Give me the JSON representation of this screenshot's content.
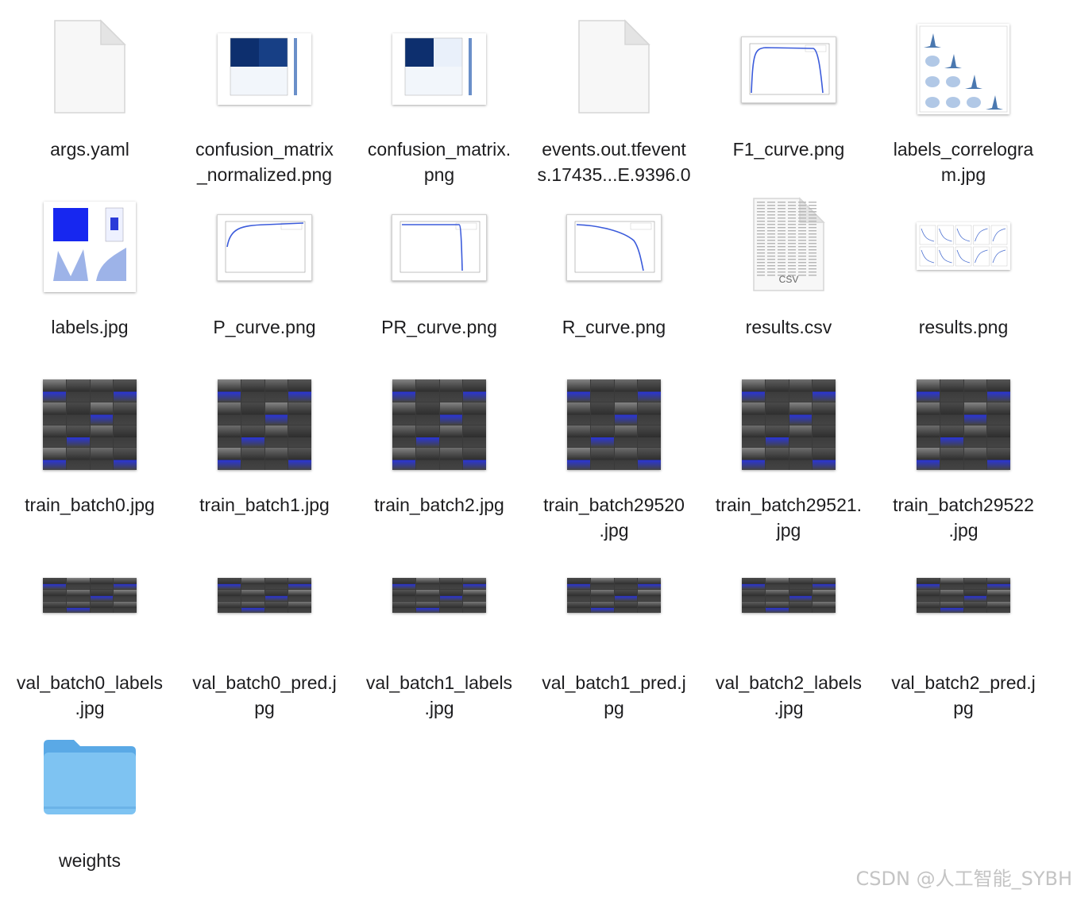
{
  "files": [
    {
      "name": "args.yaml",
      "kind": "doc"
    },
    {
      "name": "confusion_matrix_normalized.png",
      "kind": "cm"
    },
    {
      "name": "confusion_matrix.png",
      "kind": "cm2"
    },
    {
      "name": "events.out.tfevents.17435...E.9396.0",
      "kind": "doc"
    },
    {
      "name": "F1_curve.png",
      "kind": "curve"
    },
    {
      "name": "labels_correlogram.jpg",
      "kind": "correlogram"
    },
    {
      "name": "labels.jpg",
      "kind": "labels"
    },
    {
      "name": "P_curve.png",
      "kind": "curve"
    },
    {
      "name": "PR_curve.png",
      "kind": "curve"
    },
    {
      "name": "R_curve.png",
      "kind": "curve"
    },
    {
      "name": "results.csv",
      "kind": "csv"
    },
    {
      "name": "results.png",
      "kind": "results"
    },
    {
      "name": "train_batch0.jpg",
      "kind": "batch"
    },
    {
      "name": "train_batch1.jpg",
      "kind": "batch"
    },
    {
      "name": "train_batch2.jpg",
      "kind": "batch"
    },
    {
      "name": "train_batch29520.jpg",
      "kind": "batch"
    },
    {
      "name": "train_batch29521.jpg",
      "kind": "batch"
    },
    {
      "name": "train_batch29522.jpg",
      "kind": "batch"
    },
    {
      "name": "val_batch0_labels.jpg",
      "kind": "val"
    },
    {
      "name": "val_batch0_pred.jpg",
      "kind": "val"
    },
    {
      "name": "val_batch1_labels.jpg",
      "kind": "val"
    },
    {
      "name": "val_batch1_pred.jpg",
      "kind": "val"
    },
    {
      "name": "val_batch2_labels.jpg",
      "kind": "val"
    },
    {
      "name": "val_batch2_pred.jpg",
      "kind": "val"
    },
    {
      "name": "weights",
      "kind": "folder"
    }
  ],
  "labels_display": [
    "args.yaml",
    "confusion_matrix\n_normalized.png",
    "confusion_matrix.\npng",
    "events.out.tfevent\ns.17435...E.9396.0",
    "F1_curve.png",
    "labels_correlogra\nm.jpg",
    "labels.jpg",
    "P_curve.png",
    "PR_curve.png",
    "R_curve.png",
    "results.csv",
    "results.png",
    "train_batch0.jpg",
    "train_batch1.jpg",
    "train_batch2.jpg",
    "train_batch29520\n.jpg",
    "train_batch29521.\njpg",
    "train_batch29522\n.jpg",
    "val_batch0_labels\n.jpg",
    "val_batch0_pred.j\npg",
    "val_batch1_labels\n.jpg",
    "val_batch1_pred.j\npg",
    "val_batch2_labels\n.jpg",
    "val_batch2_pred.j\npg",
    "weights"
  ],
  "csv_badge": "CSV",
  "watermark": "CSDN @人工智能_SYBH",
  "colors": {
    "folder": "#7ec3f2",
    "folder_tab": "#5aa9e6",
    "cm_dark": "#0d2f6e",
    "curve_line": "#3b5bdb",
    "batch_blue": "#2a35d6"
  }
}
